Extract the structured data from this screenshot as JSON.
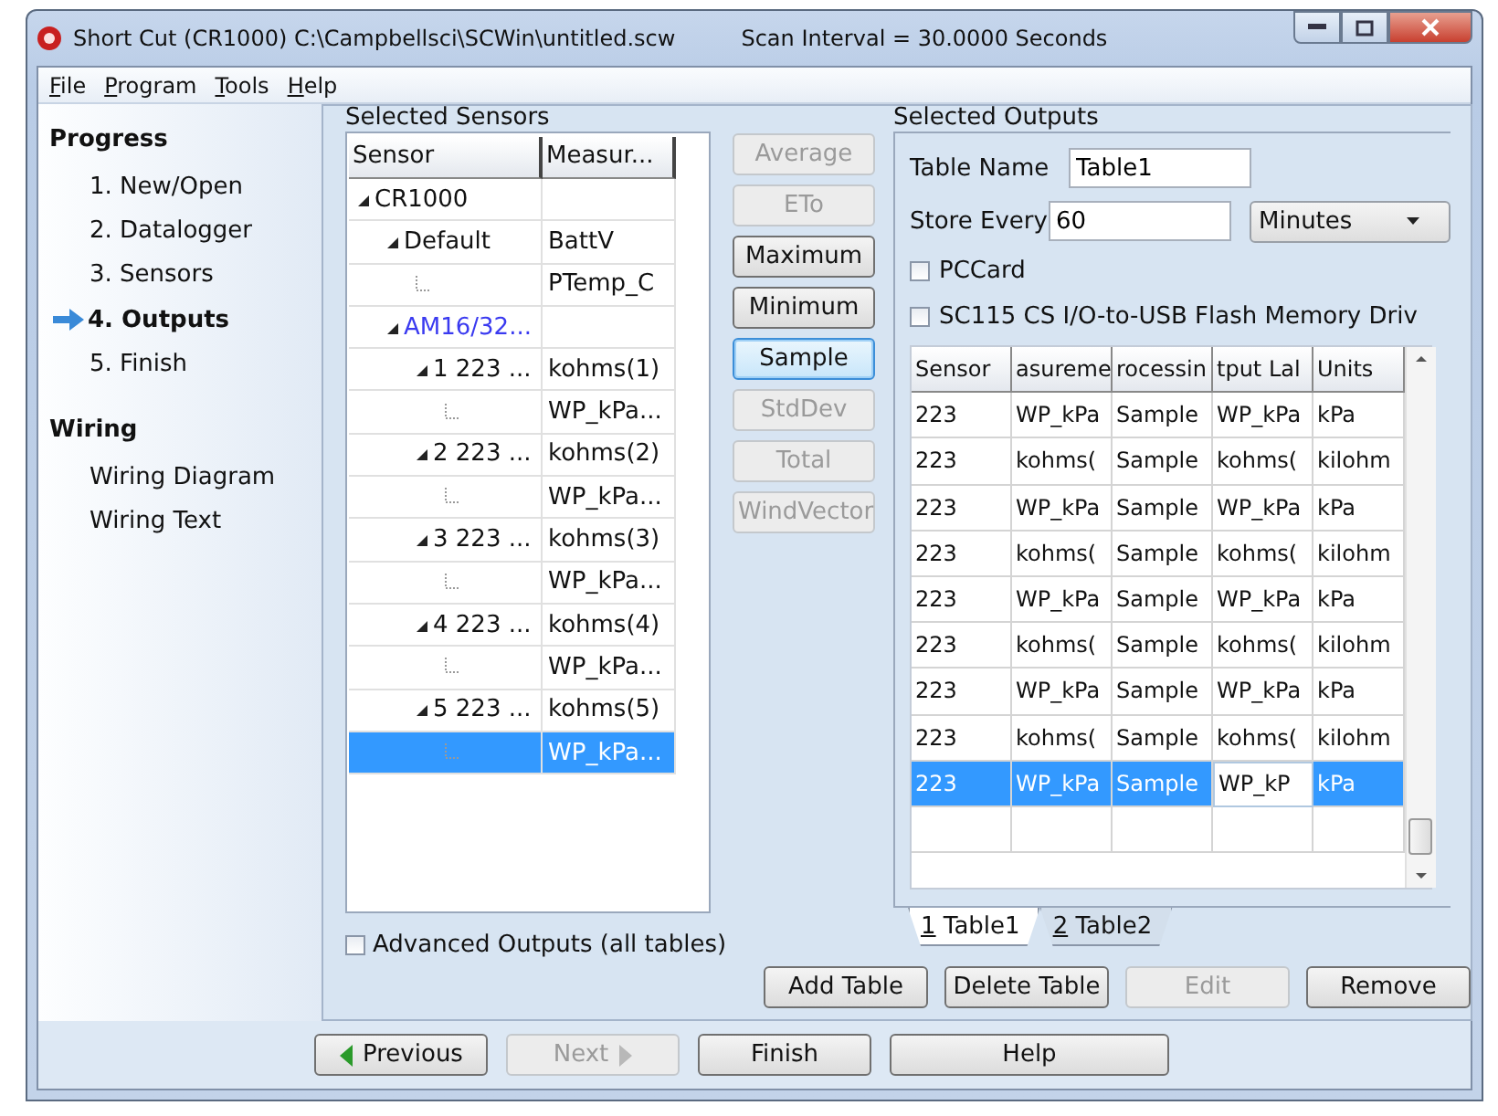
{
  "window": {
    "title": "Short Cut (CR1000) C:\\Campbellsci\\SCWin\\untitled.scw",
    "scan_interval": "Scan Interval = 30.0000 Seconds"
  },
  "menu": [
    "File",
    "Program",
    "Tools",
    "Help"
  ],
  "progress": {
    "heading": "Progress",
    "steps": [
      {
        "label": "1. New/Open",
        "current": false
      },
      {
        "label": "2. Datalogger",
        "current": false
      },
      {
        "label": "3. Sensors",
        "current": false
      },
      {
        "label": "4. Outputs",
        "current": true
      },
      {
        "label": "5. Finish",
        "current": false
      }
    ]
  },
  "wiring": {
    "heading": "Wiring",
    "items": [
      "Wiring Diagram",
      "Wiring Text"
    ]
  },
  "selected_sensors": {
    "label": "Selected Sensors",
    "columns": [
      "Sensor",
      "Measur..."
    ],
    "tree": [
      {
        "sensor": "CR1000",
        "kind": "datalogger",
        "expanded": true,
        "selected": false,
        "children": [
          {
            "sensor": "Default",
            "measurement": "BattV",
            "kind": "group",
            "expanded": true,
            "selected": false,
            "children": [
              {
                "measurement": "PTemp_C",
                "selected": false
              }
            ]
          },
          {
            "sensor": "AM16/32...",
            "kind": "multiplexer",
            "expanded": true,
            "selected": false,
            "children": [
              {
                "sensor": "1 223 ...",
                "measurement": "kohms(1)",
                "kind": "sensor",
                "expanded": true,
                "selected": false,
                "children": [
                  {
                    "measurement": "WP_kPa...",
                    "selected": false
                  }
                ]
              },
              {
                "sensor": "2 223 ...",
                "measurement": "kohms(2)",
                "kind": "sensor",
                "expanded": true,
                "selected": false,
                "children": [
                  {
                    "measurement": "WP_kPa...",
                    "selected": false
                  }
                ]
              },
              {
                "sensor": "3 223 ...",
                "measurement": "kohms(3)",
                "kind": "sensor",
                "expanded": true,
                "selected": false,
                "children": [
                  {
                    "measurement": "WP_kPa...",
                    "selected": false
                  }
                ]
              },
              {
                "sensor": "4 223 ...",
                "measurement": "kohms(4)",
                "kind": "sensor",
                "expanded": true,
                "selected": false,
                "children": [
                  {
                    "measurement": "WP_kPa...",
                    "selected": false
                  }
                ]
              },
              {
                "sensor": "5 223 ...",
                "measurement": "kohms(5)",
                "kind": "sensor",
                "expanded": true,
                "selected": false,
                "children": [
                  {
                    "measurement": "WP_kPa...",
                    "selected": true
                  }
                ]
              }
            ]
          }
        ]
      }
    ]
  },
  "processing_buttons": [
    {
      "label": "Average",
      "disabled": true,
      "focused": false
    },
    {
      "label": "ETo",
      "disabled": true,
      "focused": false
    },
    {
      "label": "Maximum",
      "disabled": false,
      "focused": false
    },
    {
      "label": "Minimum",
      "disabled": false,
      "focused": false
    },
    {
      "label": "Sample",
      "disabled": false,
      "focused": true
    },
    {
      "label": "StdDev",
      "disabled": true,
      "focused": false
    },
    {
      "label": "Total",
      "disabled": true,
      "focused": false
    },
    {
      "label": "WindVector",
      "disabled": true,
      "focused": false
    }
  ],
  "advanced_outputs": {
    "label": "Advanced Outputs (all tables)",
    "checked": false
  },
  "selected_outputs": {
    "label": "Selected Outputs",
    "table_name": {
      "label": "Table Name",
      "value": "Table1"
    },
    "store_every": {
      "label": "Store Every",
      "value": "60",
      "unit": "Minutes"
    },
    "options": [
      {
        "label": "PCCard",
        "checked": false
      },
      {
        "label": "SC115 CS I/O-to-USB Flash Memory Driv",
        "checked": false
      }
    ],
    "columns": [
      "Sensor",
      "asureme",
      "rocessin",
      "tput Lal",
      "Units"
    ],
    "rows": [
      {
        "cells": [
          "223",
          "WP_kPa",
          "Sample",
          "WP_kPa",
          "kPa"
        ],
        "selected": false
      },
      {
        "cells": [
          "223",
          "kohms(",
          "Sample",
          "kohms(",
          "kilohm"
        ],
        "selected": false
      },
      {
        "cells": [
          "223",
          "WP_kPa",
          "Sample",
          "WP_kPa",
          "kPa"
        ],
        "selected": false
      },
      {
        "cells": [
          "223",
          "kohms(",
          "Sample",
          "kohms(",
          "kilohm"
        ],
        "selected": false
      },
      {
        "cells": [
          "223",
          "WP_kPa",
          "Sample",
          "WP_kPa",
          "kPa"
        ],
        "selected": false
      },
      {
        "cells": [
          "223",
          "kohms(",
          "Sample",
          "kohms(",
          "kilohm"
        ],
        "selected": false
      },
      {
        "cells": [
          "223",
          "WP_kPa",
          "Sample",
          "WP_kPa",
          "kPa"
        ],
        "selected": false
      },
      {
        "cells": [
          "223",
          "kohms(",
          "Sample",
          "kohms(",
          "kilohm"
        ],
        "selected": false
      },
      {
        "cells": [
          "223",
          "WP_kPa",
          "Sample",
          {
            "text": "WP_kP",
            "editing": true
          },
          "kPa"
        ],
        "selected": true
      }
    ],
    "tabs": [
      {
        "label": "1 Table1",
        "selected": true
      },
      {
        "label": "2 Table2",
        "selected": false
      }
    ]
  },
  "table_buttons": [
    {
      "label": "Add Table",
      "disabled": false
    },
    {
      "label": "Delete Table",
      "disabled": false
    },
    {
      "label": "Edit",
      "disabled": true
    },
    {
      "label": "Remove",
      "disabled": false
    }
  ],
  "nav_buttons": [
    {
      "label": "Previous",
      "disabled": false
    },
    {
      "label": "Next",
      "disabled": true
    },
    {
      "label": "Finish",
      "disabled": false
    },
    {
      "label": "Help",
      "disabled": false
    }
  ]
}
